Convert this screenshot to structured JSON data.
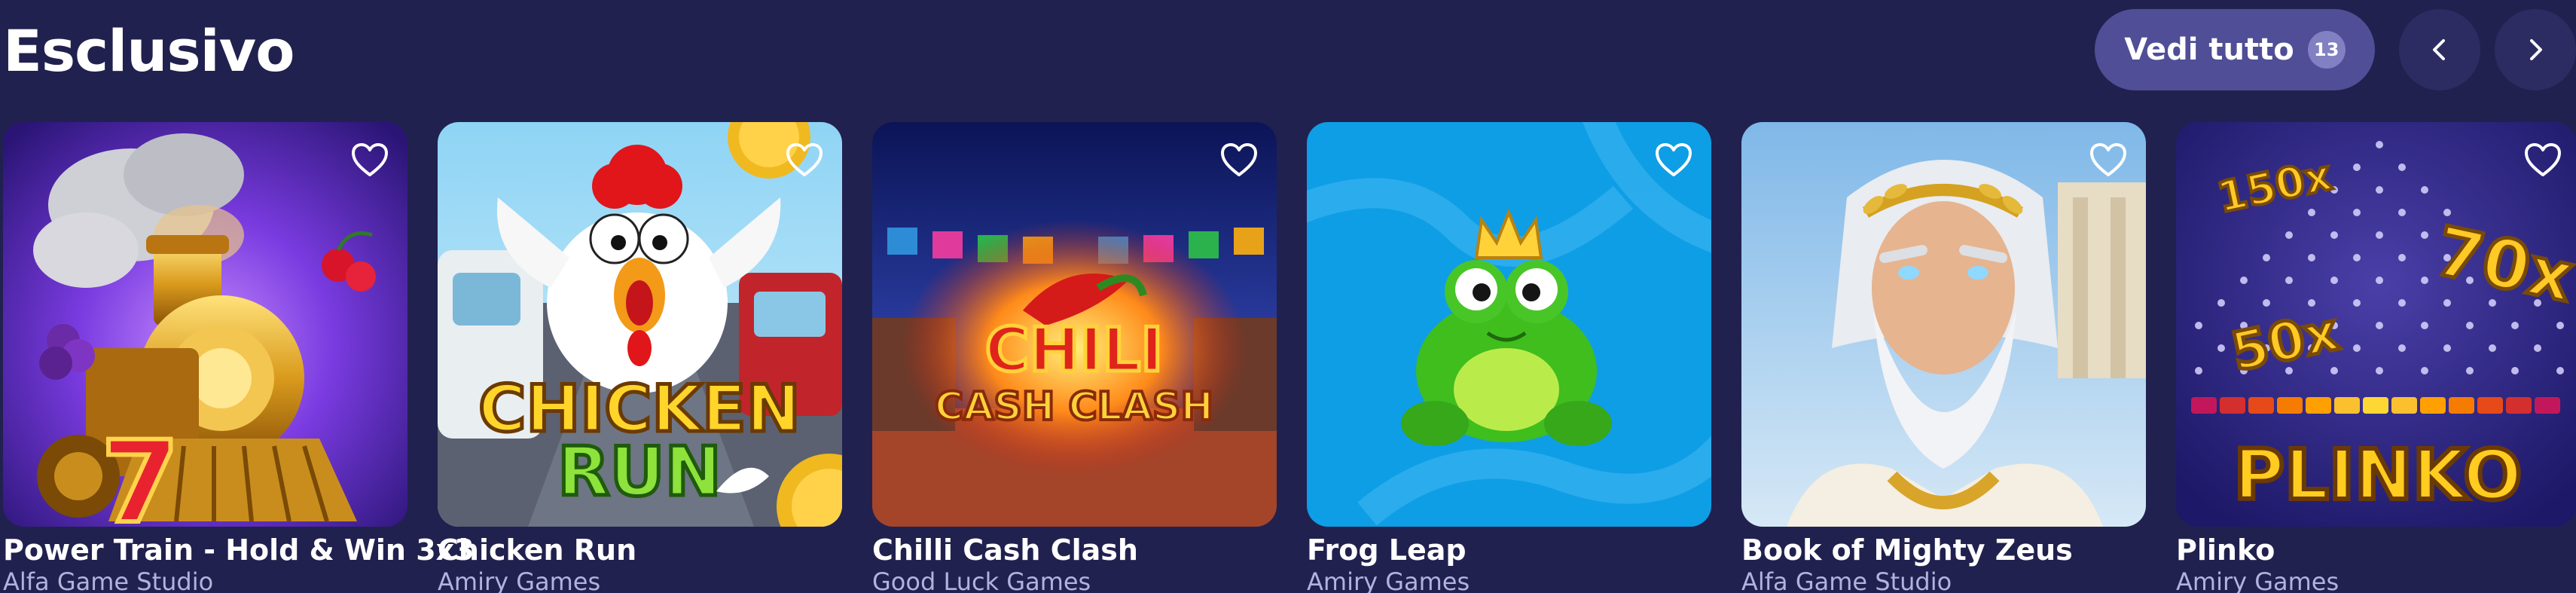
{
  "section": {
    "title": "Esclusivo",
    "view_all_label": "Vedi tutto",
    "view_all_count": "13"
  },
  "icons": {
    "prev": "chevron-left-icon",
    "next": "chevron-right-icon",
    "favorite": "heart-outline-icon"
  },
  "games": [
    {
      "title": "Power Train - Hold & Win 3x3",
      "provider": "Alfa Game Studio"
    },
    {
      "title": "Chicken Run",
      "provider": "Amiry Games",
      "logo_text_1": "CHICKEN",
      "logo_text_2": "RUN"
    },
    {
      "title": "Chilli Cash Clash",
      "provider": "Good Luck Games",
      "logo_text_1": "CHILI",
      "logo_text_2": "CASH CLASH"
    },
    {
      "title": "Frog Leap",
      "provider": "Amiry Games"
    },
    {
      "title": "Book of Mighty Zeus",
      "provider": "Alfa Game Studio"
    },
    {
      "title": "Plinko",
      "provider": "Amiry Games",
      "logo_text": "PLINKO",
      "multipliers": [
        "150x",
        "70x",
        "50x"
      ]
    }
  ],
  "colors": {
    "background": "#21214f",
    "button": "#4f4e96",
    "nav_button": "#2d2c62",
    "provider_text": "#b3b2dc"
  }
}
